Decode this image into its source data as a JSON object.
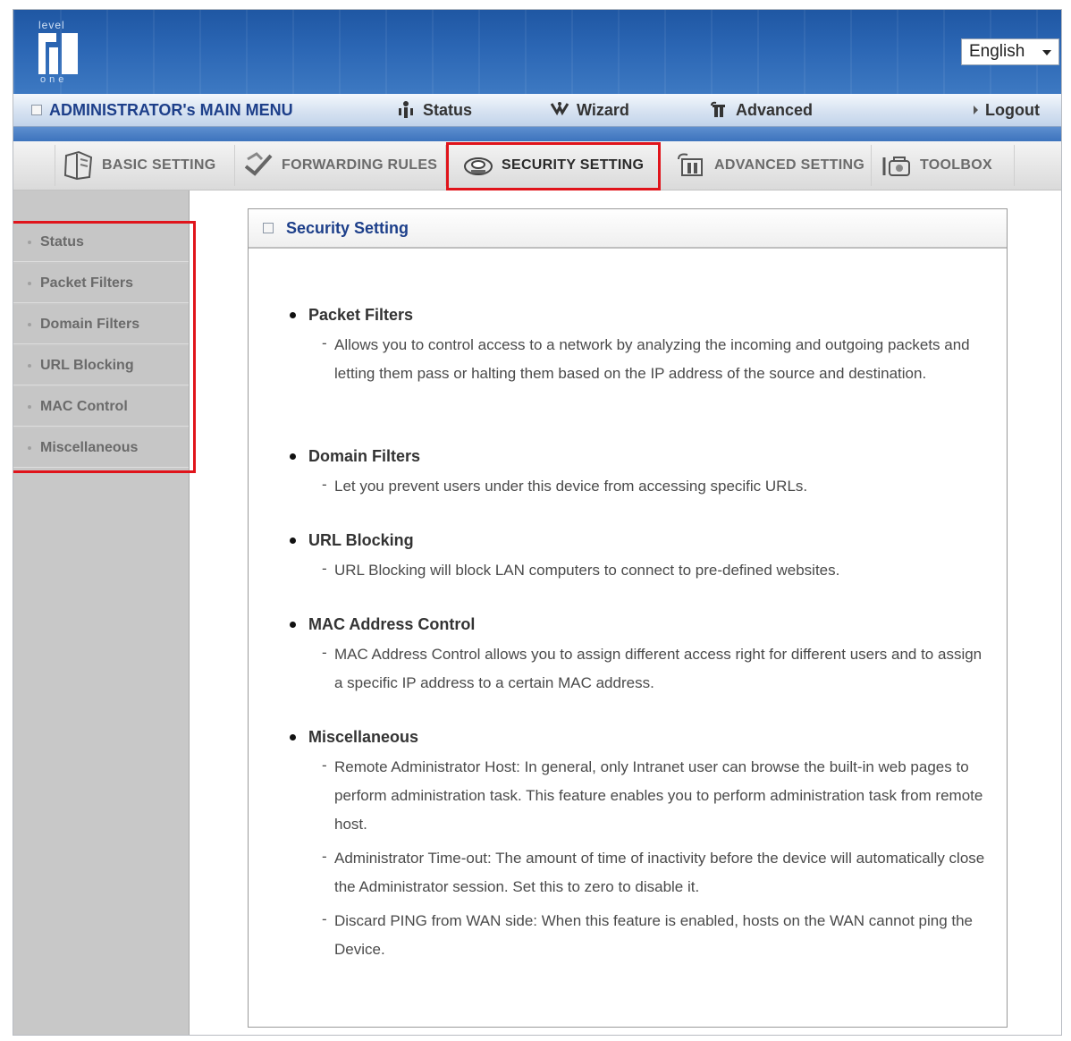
{
  "header": {
    "logo": {
      "top": "level",
      "bottom": "one"
    },
    "language": "English"
  },
  "main_menu": {
    "title": "ADMINISTRATOR's MAIN MENU",
    "items": [
      {
        "label": "Status",
        "icon": "status-icon"
      },
      {
        "label": "Wizard",
        "icon": "wizard-icon"
      },
      {
        "label": "Advanced",
        "icon": "advanced-icon"
      }
    ],
    "logout": "Logout"
  },
  "tabs": [
    {
      "label": "BASIC SETTING",
      "icon": "notebook-icon"
    },
    {
      "label": "FORWARDING RULES",
      "icon": "forward-icon"
    },
    {
      "label": "SECURITY SETTING",
      "icon": "security-icon",
      "active": true
    },
    {
      "label": "ADVANCED SETTING",
      "icon": "advanced-setting-icon"
    },
    {
      "label": "TOOLBOX",
      "icon": "toolbox-icon"
    }
  ],
  "sidebar": {
    "items": [
      {
        "label": "Status"
      },
      {
        "label": "Packet Filters"
      },
      {
        "label": "Domain Filters"
      },
      {
        "label": "URL Blocking"
      },
      {
        "label": "MAC Control"
      },
      {
        "label": "Miscellaneous"
      }
    ]
  },
  "panel": {
    "title": "Security Setting",
    "sections": [
      {
        "title": "Packet Filters",
        "desc": [
          "Allows you to control access to a network by analyzing the incoming and outgoing packets and letting them pass or halting them based on the IP address of the source and destination."
        ]
      },
      {
        "title": "Domain Filters",
        "desc": [
          "Let you prevent users under this device from accessing specific URLs."
        ]
      },
      {
        "title": "URL Blocking",
        "desc": [
          "URL Blocking will block LAN computers to connect to pre-defined websites."
        ]
      },
      {
        "title": "MAC Address Control",
        "desc": [
          "MAC Address Control allows you to assign different access right for different users and to assign a specific IP address to a certain MAC address."
        ]
      },
      {
        "title": "Miscellaneous",
        "desc": [
          "Remote Administrator Host: In general, only Intranet user can browse the built-in web pages to perform administration task. This feature enables you to perform administration task from remote host.",
          "Administrator Time-out: The amount of time of inactivity before the device will automatically close the Administrator session. Set this to zero to disable it.",
          "Discard PING from WAN side: When this feature is enabled, hosts on the WAN cannot ping the Device."
        ]
      }
    ]
  },
  "colors": {
    "header_blue": "#2b66b4",
    "menu_title": "#1d3f8a",
    "highlight_red": "#e0141b",
    "sidebar_gray": "#c8c8c8"
  }
}
